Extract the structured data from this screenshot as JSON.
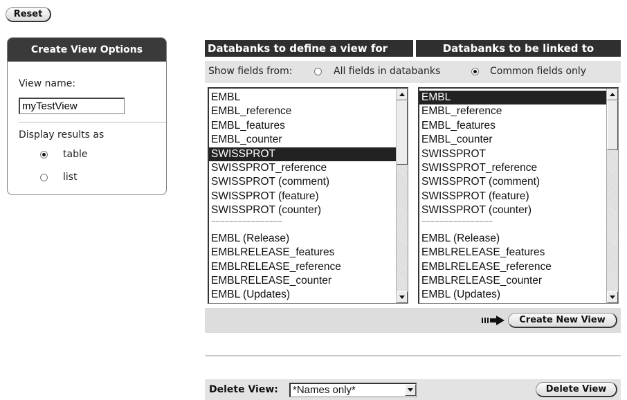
{
  "toolbar": {
    "reset_label": "Reset"
  },
  "options_panel": {
    "title": "Create View Options",
    "view_name_label": "View name:",
    "view_name_value": "myTestView",
    "display_label": "Display results as",
    "display_options": [
      {
        "label": "table",
        "checked": true
      },
      {
        "label": "list",
        "checked": false
      }
    ]
  },
  "columns": {
    "define_header": "Databanks to define a view for",
    "linked_header": "Databanks to be linked to"
  },
  "show_fields": {
    "label": "Show fields from:",
    "options": [
      {
        "label": "All fields in databanks",
        "checked": false
      },
      {
        "label": "Common fields only",
        "checked": true
      }
    ]
  },
  "define_list": {
    "items": [
      "EMBL",
      "EMBL_reference",
      "EMBL_features",
      "EMBL_counter",
      "SWISSPROT",
      "SWISSPROT_reference",
      "SWISSPROT (comment)",
      "SWISSPROT (feature)",
      "SWISSPROT (counter)",
      "~~~~~~~~~~~~~~~~",
      "EMBL (Release)",
      "EMBLRELEASE_features",
      "EMBLRELEASE_reference",
      "EMBLRELEASE_counter",
      "EMBL (Updates)"
    ],
    "selected": "SWISSPROT"
  },
  "linked_list": {
    "items": [
      "EMBL",
      "EMBL_reference",
      "EMBL_features",
      "EMBL_counter",
      "SWISSPROT",
      "SWISSPROT_reference",
      "SWISSPROT (comment)",
      "SWISSPROT (feature)",
      "SWISSPROT (counter)",
      "~~~~~~~~~~~~~~~~",
      "EMBL (Release)",
      "EMBLRELEASE_features",
      "EMBLRELEASE_reference",
      "EMBLRELEASE_counter",
      "EMBL (Updates)"
    ],
    "selected": "EMBL"
  },
  "actions": {
    "create_label": "Create New View"
  },
  "delete_section": {
    "label": "Delete View:",
    "select_value": "*Names only*",
    "button_label": "Delete View"
  },
  "icons": {
    "forward_arrow": "forward-arrow-icon",
    "scroll_up": "scroll-up-arrow-icon",
    "scroll_down": "scroll-down-arrow-icon",
    "dropdown": "dropdown-arrow-icon"
  }
}
